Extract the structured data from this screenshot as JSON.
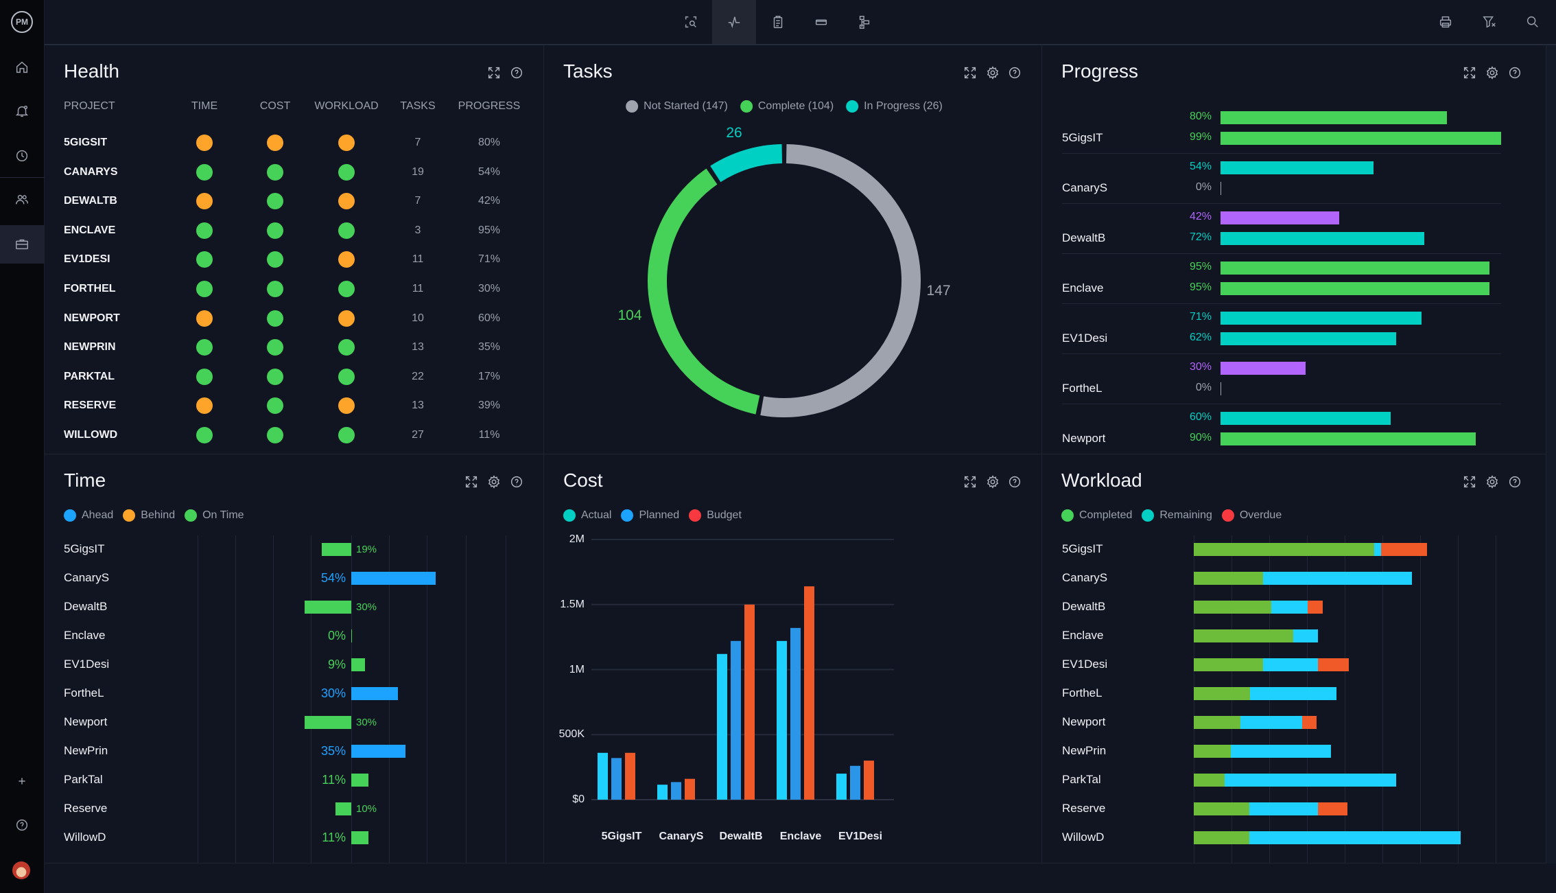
{
  "colors": {
    "orange": "#ffa42a",
    "green": "#46d159",
    "teal": "#00d0c4",
    "purple": "#b165fb",
    "blue": "#1ba3ff",
    "cyan": "#1ed1ff",
    "planned": "#2b95e8",
    "red": "#f05a28",
    "gray": "#9fa3ad",
    "olive": "#6dbd3b"
  },
  "app": {
    "logo": "PM"
  },
  "sidebar": {
    "items": [
      {
        "name": "home-icon"
      },
      {
        "name": "bell-icon"
      },
      {
        "name": "clock-icon"
      },
      {
        "name": "users-icon"
      },
      {
        "name": "briefcase-icon",
        "active": true
      }
    ],
    "bottom": [
      {
        "name": "plus-icon"
      },
      {
        "name": "help-icon"
      },
      {
        "name": "avatar"
      }
    ]
  },
  "toolbar": {
    "center": [
      {
        "name": "zoom-fit-icon"
      },
      {
        "name": "dashboard-pulse-icon",
        "active": true
      },
      {
        "name": "clipboard-icon"
      },
      {
        "name": "minus-box-icon"
      },
      {
        "name": "hierarchy-icon"
      }
    ],
    "right": [
      {
        "name": "print-icon"
      },
      {
        "name": "filter-clear-icon"
      },
      {
        "name": "search-icon"
      }
    ]
  },
  "health": {
    "title": "Health",
    "columns": [
      "PROJECT",
      "TIME",
      "COST",
      "WORKLOAD",
      "TASKS",
      "PROGRESS"
    ],
    "rows": [
      {
        "project": "5GIGSIT",
        "time": "orange",
        "cost": "orange",
        "workload": "orange",
        "tasks": "7",
        "progress": "80%"
      },
      {
        "project": "CANARYS",
        "time": "green",
        "cost": "green",
        "workload": "green",
        "tasks": "19",
        "progress": "54%"
      },
      {
        "project": "DEWALTB",
        "time": "orange",
        "cost": "green",
        "workload": "orange",
        "tasks": "7",
        "progress": "42%"
      },
      {
        "project": "ENCLAVE",
        "time": "green",
        "cost": "green",
        "workload": "green",
        "tasks": "3",
        "progress": "95%"
      },
      {
        "project": "EV1DESI",
        "time": "green",
        "cost": "green",
        "workload": "orange",
        "tasks": "11",
        "progress": "71%"
      },
      {
        "project": "FORTHEL",
        "time": "green",
        "cost": "green",
        "workload": "green",
        "tasks": "11",
        "progress": "30%"
      },
      {
        "project": "NEWPORT",
        "time": "orange",
        "cost": "green",
        "workload": "orange",
        "tasks": "10",
        "progress": "60%"
      },
      {
        "project": "NEWPRIN",
        "time": "green",
        "cost": "green",
        "workload": "green",
        "tasks": "13",
        "progress": "35%"
      },
      {
        "project": "PARKTAL",
        "time": "green",
        "cost": "green",
        "workload": "green",
        "tasks": "22",
        "progress": "17%"
      },
      {
        "project": "RESERVE",
        "time": "orange",
        "cost": "green",
        "workload": "orange",
        "tasks": "13",
        "progress": "39%"
      },
      {
        "project": "WILLOWD",
        "time": "green",
        "cost": "green",
        "workload": "green",
        "tasks": "27",
        "progress": "11%"
      }
    ]
  },
  "tasks": {
    "title": "Tasks",
    "legend": [
      "Not Started (147)",
      "Complete (104)",
      "In Progress (26)"
    ],
    "chart_data": {
      "type": "pie",
      "slices": [
        {
          "label": "Not Started",
          "value": 147,
          "text": "147",
          "color": "#9fa3ad"
        },
        {
          "label": "Complete",
          "value": 104,
          "text": "104",
          "color": "#46d159"
        },
        {
          "label": "In Progress",
          "value": 26,
          "text": "26",
          "color": "#00d0c4"
        }
      ]
    }
  },
  "progress": {
    "title": "Progress",
    "rows": [
      {
        "name": "5GigsIT",
        "bars": [
          {
            "label": "80%",
            "value": 80,
            "color": "#46d159"
          },
          {
            "label": "99%",
            "value": 99,
            "color": "#46d159"
          }
        ]
      },
      {
        "name": "CanaryS",
        "bars": [
          {
            "label": "54%",
            "value": 54,
            "color": "#00d0c4"
          },
          {
            "label": "0%",
            "value": 0,
            "color": "#9fa3ad"
          }
        ]
      },
      {
        "name": "DewaltB",
        "bars": [
          {
            "label": "42%",
            "value": 42,
            "color": "#b165fb"
          },
          {
            "label": "72%",
            "value": 72,
            "color": "#00d0c4"
          }
        ]
      },
      {
        "name": "Enclave",
        "bars": [
          {
            "label": "95%",
            "value": 95,
            "color": "#46d159"
          },
          {
            "label": "95%",
            "value": 95,
            "color": "#46d159"
          }
        ]
      },
      {
        "name": "EV1Desi",
        "bars": [
          {
            "label": "71%",
            "value": 71,
            "color": "#00d0c4"
          },
          {
            "label": "62%",
            "value": 62,
            "color": "#00d0c4"
          }
        ]
      },
      {
        "name": "FortheL",
        "bars": [
          {
            "label": "30%",
            "value": 30,
            "color": "#b165fb"
          },
          {
            "label": "0%",
            "value": 0,
            "color": "#9fa3ad"
          }
        ]
      },
      {
        "name": "Newport",
        "bars": [
          {
            "label": "60%",
            "value": 60,
            "color": "#00d0c4"
          },
          {
            "label": "90%",
            "value": 90,
            "color": "#46d159"
          }
        ]
      }
    ]
  },
  "time": {
    "title": "Time",
    "legend": [
      {
        "label": "Ahead",
        "color": "#1ba3ff"
      },
      {
        "label": "Behind",
        "color": "#ffa42a"
      },
      {
        "label": "On Time",
        "color": "#46d159"
      }
    ],
    "chart_data": {
      "type": "bar",
      "orientation": "horizontal",
      "rows": [
        {
          "name": "5GigsIT",
          "label": "19%",
          "value": -19,
          "color": "#46d159"
        },
        {
          "name": "CanaryS",
          "label": "54%",
          "value": 54,
          "color": "#1ba3ff"
        },
        {
          "name": "DewaltB",
          "label": "30%",
          "value": -30,
          "color": "#46d159"
        },
        {
          "name": "Enclave",
          "label": "0%",
          "value": 0,
          "color": "#46d159"
        },
        {
          "name": "EV1Desi",
          "label": "9%",
          "value": 9,
          "color": "#46d159"
        },
        {
          "name": "FortheL",
          "label": "30%",
          "value": 30,
          "color": "#1ba3ff"
        },
        {
          "name": "Newport",
          "label": "30%",
          "value": -30,
          "color": "#46d159"
        },
        {
          "name": "NewPrin",
          "label": "35%",
          "value": 35,
          "color": "#1ba3ff"
        },
        {
          "name": "ParkTal",
          "label": "11%",
          "value": 11,
          "color": "#46d159"
        },
        {
          "name": "Reserve",
          "label": "10%",
          "value": -10,
          "color": "#46d159"
        },
        {
          "name": "WillowD",
          "label": "11%",
          "value": 11,
          "color": "#46d159"
        }
      ]
    }
  },
  "cost": {
    "title": "Cost",
    "legend": [
      {
        "label": "Actual",
        "color": "#00d0c4"
      },
      {
        "label": "Planned",
        "color": "#1ba3ff"
      },
      {
        "label": "Budget",
        "color": "#f8393f"
      }
    ],
    "chart_data": {
      "type": "bar",
      "categories": [
        "5GigsIT",
        "CanaryS",
        "DewaltB",
        "Enclave",
        "EV1Desi"
      ],
      "ylim": [
        0,
        2000000
      ],
      "yticks": [
        "$0",
        "500K",
        "1M",
        "1.5M",
        "2M"
      ],
      "grid": true,
      "series": [
        {
          "name": "Actual",
          "color": "#1ed1ff",
          "values": [
            360000,
            115000,
            1120000,
            1220000,
            200000
          ]
        },
        {
          "name": "Planned",
          "color": "#2b95e8",
          "values": [
            320000,
            135000,
            1220000,
            1320000,
            260000
          ]
        },
        {
          "name": "Budget",
          "color": "#f05a28",
          "values": [
            360000,
            160000,
            1500000,
            1640000,
            300000
          ]
        }
      ]
    }
  },
  "workload": {
    "title": "Workload",
    "legend": [
      {
        "label": "Completed",
        "color": "#46d159"
      },
      {
        "label": "Remaining",
        "color": "#00d0c4"
      },
      {
        "label": "Overdue",
        "color": "#f8393f"
      }
    ],
    "chart_data": {
      "type": "bar",
      "orientation": "horizontal",
      "stacked": true,
      "categories": [
        "5GigsIT",
        "CanaryS",
        "DewaltB",
        "Enclave",
        "EV1Desi",
        "FortheL",
        "Newport",
        "NewPrin",
        "ParkTal",
        "Reserve",
        "WillowD"
      ],
      "series": [
        {
          "name": "Completed",
          "color": "#6dbd3b",
          "values": [
            182,
            70,
            78,
            100,
            70,
            57,
            47,
            37,
            31,
            56,
            56
          ]
        },
        {
          "name": "Remaining",
          "color": "#1ed1ff",
          "values": [
            7,
            150,
            37,
            25,
            55,
            87,
            62,
            101,
            173,
            69,
            213
          ]
        },
        {
          "name": "Overdue",
          "color": "#f05a28",
          "values": [
            46,
            0,
            15,
            0,
            31,
            0,
            15,
            0,
            0,
            30,
            0
          ]
        }
      ]
    }
  }
}
